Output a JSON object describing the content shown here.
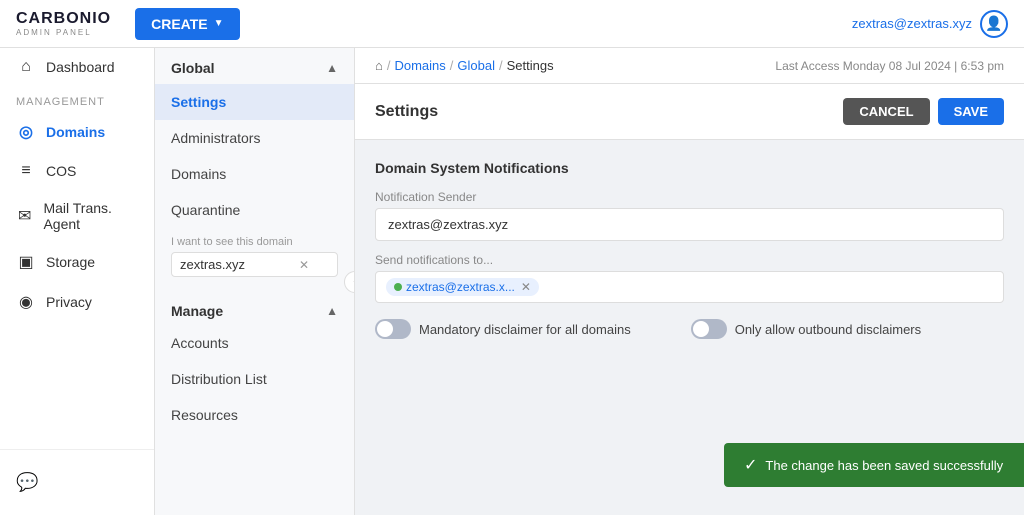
{
  "topbar": {
    "logo_text": "CARBONIO",
    "logo_sub": "ADMIN PANEL",
    "create_label": "CREATE",
    "user_email": "zextras@zextras.xyz"
  },
  "sidebar": {
    "management_label": "Management",
    "items": [
      {
        "id": "dashboard",
        "label": "Dashboard",
        "icon": "⌂"
      },
      {
        "id": "domains",
        "label": "Domains",
        "icon": "◎"
      },
      {
        "id": "cos",
        "label": "COS",
        "icon": "≡"
      },
      {
        "id": "mail-trans-agent",
        "label": "Mail Trans. Agent",
        "icon": "✉"
      },
      {
        "id": "storage",
        "label": "Storage",
        "icon": "▣"
      },
      {
        "id": "privacy",
        "label": "Privacy",
        "icon": "◉"
      }
    ],
    "chat_icon": "💬"
  },
  "breadcrumb": {
    "home_icon": "⌂",
    "segments": [
      "Domains",
      "Global",
      "Settings"
    ],
    "last_access": "Last Access Monday 08 Jul 2024 | 6:53 pm"
  },
  "middle_panel": {
    "global_label": "Global",
    "nav_items": [
      {
        "id": "settings",
        "label": "Settings",
        "active": true
      },
      {
        "id": "administrators",
        "label": "Administrators"
      },
      {
        "id": "domains",
        "label": "Domains"
      },
      {
        "id": "quarantine",
        "label": "Quarantine"
      }
    ],
    "domain_filter_label": "I want to see this domain",
    "domain_filter_value": "zextras.xyz",
    "manage_label": "Manage",
    "manage_items": [
      {
        "id": "accounts",
        "label": "Accounts"
      },
      {
        "id": "distribution-list",
        "label": "Distribution List"
      },
      {
        "id": "resources",
        "label": "Resources"
      }
    ]
  },
  "settings": {
    "title": "Settings",
    "cancel_label": "CANCEL",
    "save_label": "SAVE",
    "section_title": "Domain System Notifications",
    "notification_sender_label": "Notification Sender",
    "notification_sender_value": "zextras@zextras.xyz",
    "send_notifications_label": "Send notifications to...",
    "send_notifications_tag": "zextras@zextras.x...",
    "toggle1_label": "Mandatory disclaimer for all domains",
    "toggle2_label": "Only allow outbound disclaimers"
  },
  "toast": {
    "check_icon": "✓",
    "message": "The change has been saved successfully"
  }
}
